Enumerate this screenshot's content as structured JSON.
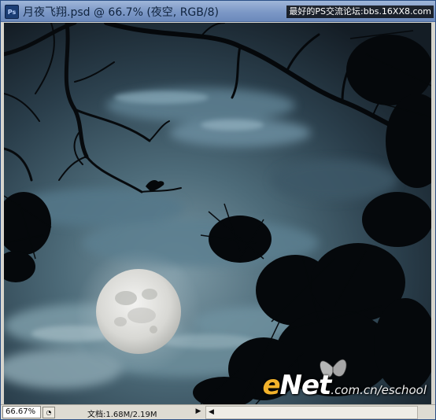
{
  "window": {
    "title": "月夜飞翔.psd @ 66.7% (夜空, RGB/8)",
    "app_icon": "ps-document-icon",
    "app_icon_label": "Ps"
  },
  "watermark": {
    "top_text": "最好的PS交流论坛:bbs.16XX8.com",
    "logo_e": "e",
    "logo_rest": "Net",
    "logo_url": ".com.cn/eschool"
  },
  "canvas": {
    "scene": "night sky with full moon, clouds and tree silhouettes",
    "moon_color": "#d9d9d6",
    "sky_color": "#3b5766"
  },
  "statusbar": {
    "zoom": "66.67%",
    "info_icon": "info-menu-icon",
    "info_icon_glyph": "◔",
    "doc_info": "文档:1.68M/2.19M",
    "arrow_icon": "triangle-right-icon",
    "arrow_icon_glyph": "▶",
    "scroll_left_icon": "scroll-left-icon",
    "scroll_left_glyph": "◀"
  },
  "colors": {
    "titlebar": "#7c98c6",
    "statusbar": "#dedbd2",
    "logo_accent": "#f2b22b"
  }
}
